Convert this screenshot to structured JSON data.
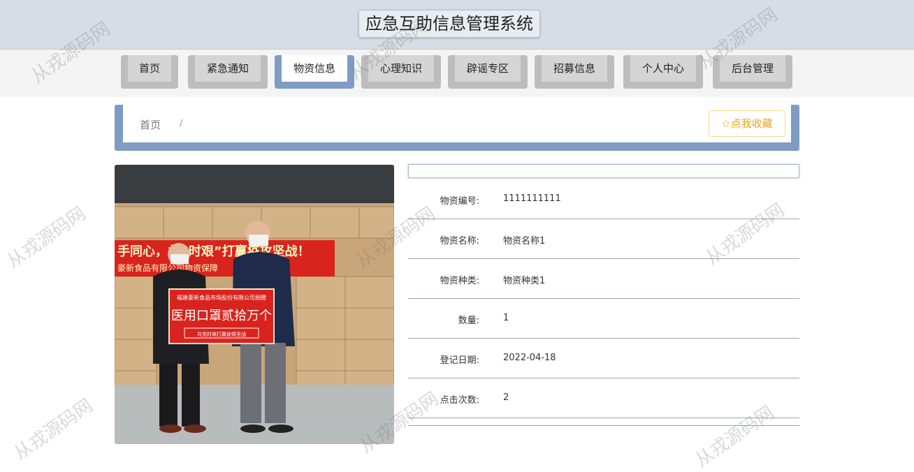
{
  "header": {
    "title": "应急互助信息管理系统"
  },
  "nav": {
    "items": [
      {
        "label": "首页"
      },
      {
        "label": "紧急通知"
      },
      {
        "label": "物资信息"
      },
      {
        "label": "心理知识"
      },
      {
        "label": "辟谣专区"
      },
      {
        "label": "招募信息"
      },
      {
        "label": "个人中心"
      },
      {
        "label": "后台管理"
      }
    ],
    "active_index": 2
  },
  "breadcrumb": {
    "home": "首页",
    "separator": "/"
  },
  "favorite": {
    "icon": "star-outline-icon",
    "label": "点我收藏"
  },
  "photo": {
    "banner_top": "手同心，共“时艰”打赢疫攻坚战！",
    "banner_sub": "豪新食品有限公司物资保障",
    "sign_top": "福建豪新食品市场股份有限公司捐赠",
    "sign_main": "医用口罩贰拾万个",
    "sign_bottom": "共克时艰打赢疫情坚战"
  },
  "details": [
    {
      "label": "物资编号:",
      "value": "1111111111"
    },
    {
      "label": "物资名称:",
      "value": "物资名称1"
    },
    {
      "label": "物资种类:",
      "value": "物资种类1"
    },
    {
      "label": "数量:",
      "value": "1"
    },
    {
      "label": "登记日期:",
      "value": "2022-04-18"
    },
    {
      "label": "点击次数:",
      "value": "2"
    }
  ],
  "watermark": {
    "text": "从戎源码网"
  },
  "colors": {
    "accent": "#7e9cc4",
    "favorite": "#e6a817",
    "header_bg": "#d6dde6"
  }
}
